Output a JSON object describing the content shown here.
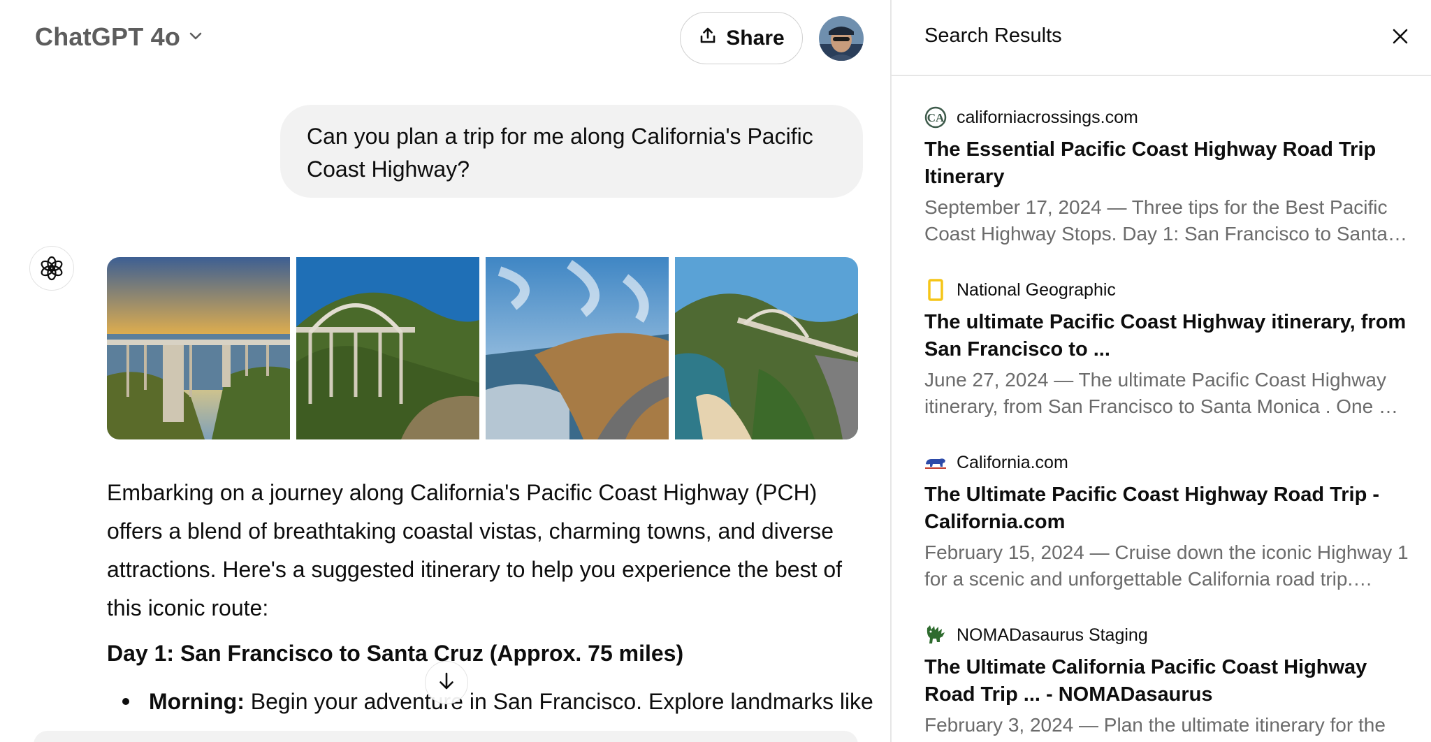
{
  "header": {
    "model_name": "ChatGPT 4o",
    "share_label": "Share"
  },
  "conversation": {
    "user_message": "Can  you plan  a trip for me along California's Pacific Coast Highway?",
    "assistant": {
      "intro": "Embarking on a journey along California's Pacific Coast Highway (PCH) offers a blend of breathtaking coastal vistas, charming towns, and diverse attractions. Here's a suggested itinerary to help you experience the best of this iconic route:",
      "day1_heading": "Day 1: San Francisco to Santa Cruz (Approx. 75 miles)",
      "bullet_label": "Morning:",
      "bullet_text": " Begin your adventure in San Francisco. Explore landmarks like"
    }
  },
  "search_panel": {
    "title": "Search Results",
    "results": [
      {
        "source": "californiacrossings.com",
        "title": "The Essential Pacific Coast Highway Road Trip Itinerary",
        "snippet": "September 17, 2024 — Three tips for the Best Pacific Coast Highway Stops. Day 1: San Francisco to Santa…",
        "favicon": "ca-logo-icon"
      },
      {
        "source": "National Geographic",
        "title": "The ultimate Pacific Coast Highway itinerary, from San Francisco to ...",
        "snippet": "June 27, 2024 — The ultimate Pacific Coast Highway itinerary, from San Francisco to Santa Monica . One …",
        "favicon": "natgeo-frame-icon"
      },
      {
        "source": "California.com",
        "title": "The Ultimate Pacific Coast Highway Road Trip - California.com",
        "snippet": "February 15, 2024 — Cruise down the iconic Highway 1 for a scenic and unforgettable California road trip.…",
        "favicon": "bear-icon"
      },
      {
        "source": "NOMADasaurus Staging",
        "title": "The Ultimate California Pacific Coast Highway Road Trip ... - NOMADasaurus",
        "snippet": "February 3, 2024 — Plan the ultimate itinerary for the",
        "favicon": "dinosaur-icon"
      }
    ]
  },
  "colors": {
    "bubble_bg": "#f2f2f2",
    "snippet_text": "#6b6b6b",
    "divider": "#e6e6e6",
    "natgeo_yellow": "#f5c518",
    "california_blue": "#2c4aa8",
    "nomad_green": "#2e6b2e"
  }
}
